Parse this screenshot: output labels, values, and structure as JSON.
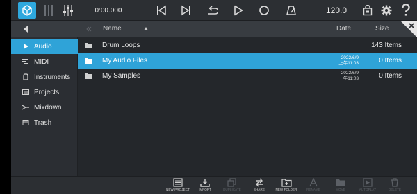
{
  "toolbar": {
    "time": "0:00.000",
    "tempo": "120.0",
    "colors": {
      "accent": "#2fa3d8",
      "icon": "#d9d9d9"
    }
  },
  "header": {
    "name_label": "Name",
    "date_label": "Date",
    "size_label": "Size"
  },
  "sidebar": {
    "items": [
      {
        "label": "Audio",
        "icon": "play-triangle-icon",
        "active": true
      },
      {
        "label": "MIDI",
        "icon": "midi-icon",
        "active": false
      },
      {
        "label": "Instruments",
        "icon": "instrument-icon",
        "active": false
      },
      {
        "label": "Projects",
        "icon": "projects-icon",
        "active": false
      },
      {
        "label": "Mixdown",
        "icon": "mixdown-icon",
        "active": false
      },
      {
        "label": "Trash",
        "icon": "trash-icon",
        "active": false
      }
    ]
  },
  "files": [
    {
      "name": "Drum Loops",
      "date_line1": "",
      "date_line2": "",
      "size": "143 Items",
      "selected": false
    },
    {
      "name": "My Audio Files",
      "date_line1": "2022/6/9",
      "date_line2": "上午11:03",
      "size": "0 Items",
      "selected": true
    },
    {
      "name": "My Samples",
      "date_line1": "2022/6/9",
      "date_line2": "上午11:03",
      "size": "0 Items",
      "selected": false
    }
  ],
  "bottom_bar": {
    "buttons": [
      {
        "label": "NEW PROJECT",
        "enabled": true
      },
      {
        "label": "IMPORT",
        "enabled": true
      },
      {
        "label": "DUPLICATE",
        "enabled": false
      },
      {
        "label": "SHARE",
        "enabled": true
      },
      {
        "label": "NEW FOLDER",
        "enabled": true
      },
      {
        "label": "RENAME",
        "enabled": false
      },
      {
        "label": "MOVE",
        "enabled": false
      },
      {
        "label": "AUTOPLAY",
        "enabled": false
      },
      {
        "label": "DELETE",
        "enabled": false
      }
    ]
  }
}
